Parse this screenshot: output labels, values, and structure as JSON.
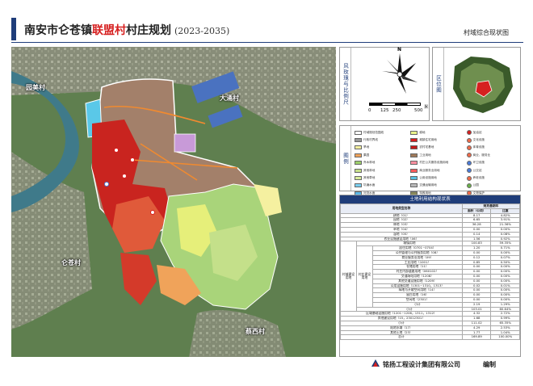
{
  "header": {
    "title_prefix": "南安市仑苍镇",
    "title_highlight": "联盟村",
    "title_suffix": "村庄规划",
    "title_years": "(2023-2035)",
    "subtitle": "村域综合现状图"
  },
  "map": {
    "places": [
      {
        "key": "yuanmei",
        "label": "园美村"
      },
      {
        "key": "dayong",
        "label": "大涌村"
      },
      {
        "key": "cangsu",
        "label": "仑苍村"
      },
      {
        "key": "caixi",
        "label": "蔡西村"
      }
    ]
  },
  "compass": {
    "label": "风玫瑰与比例尺",
    "north": "N",
    "scale_ticks": [
      "0",
      "125",
      "250",
      "500"
    ],
    "scale_unit": "米"
  },
  "location": {
    "label": "区位图"
  },
  "legend": {
    "label": "图例",
    "items": [
      {
        "text": "村域规划范围线",
        "color": "#ffffff",
        "shape": "box"
      },
      {
        "text": "耕地",
        "color": "#e8f28a",
        "shape": "box"
      },
      {
        "text": "加油站",
        "color": "#d62020",
        "shape": "dot"
      },
      {
        "text": "行政村界线",
        "color": "#999999",
        "shape": "box"
      },
      {
        "text": "城镇住宅用地",
        "color": "#d62020",
        "shape": "box"
      },
      {
        "text": "文化设施",
        "color": "#ef6a4a",
        "shape": "dot"
      },
      {
        "text": "旱地",
        "color": "#f5f0a0",
        "shape": "box"
      },
      {
        "text": "农村宅基地",
        "color": "#c41a1a",
        "shape": "box"
      },
      {
        "text": "体育设施",
        "color": "#ef6a4a",
        "shape": "dot"
      },
      {
        "text": "果园",
        "color": "#f0a35a",
        "shape": "box"
      },
      {
        "text": "工业用地",
        "color": "#a07a5a",
        "shape": "box"
      },
      {
        "text": "商业、服务业",
        "color": "#ef6a4a",
        "shape": "dot"
      },
      {
        "text": "乔木林地",
        "color": "#9ccf6a",
        "shape": "box"
      },
      {
        "text": "村庄公共服务设施用地",
        "color": "#ff8fa0",
        "shape": "box"
      },
      {
        "text": "环卫设施",
        "color": "#4a7ad8",
        "shape": "dot"
      },
      {
        "text": "其他林地",
        "color": "#c8e08a",
        "shape": "box"
      },
      {
        "text": "商业服务业用地",
        "color": "#ff5a5a",
        "shape": "box"
      },
      {
        "text": "公交站",
        "color": "#4a7ad8",
        "shape": "dot"
      },
      {
        "text": "其他草地",
        "color": "#d8ec9a",
        "shape": "box"
      },
      {
        "text": "公用设施用地",
        "color": "#5ac0e0",
        "shape": "box"
      },
      {
        "text": "养老设施",
        "color": "#ef6a4a",
        "shape": "dot"
      },
      {
        "text": "坑塘水面",
        "color": "#7ad0f0",
        "shape": "box"
      },
      {
        "text": "交通运输用地",
        "color": "#b8b8b8",
        "shape": "box"
      },
      {
        "text": "公园",
        "color": "#6ab04a",
        "shape": "dot"
      },
      {
        "text": "河流水面",
        "color": "#5ab8e8",
        "shape": "box"
      },
      {
        "text": "特殊用地",
        "color": "#8a8a5a",
        "shape": "box"
      },
      {
        "text": "文物保护",
        "color": "#ef6a4a",
        "shape": "dot"
      }
    ]
  },
  "table": {
    "title": "土地利用结构现状表",
    "head": {
      "col1": "用地类型名称",
      "col2": "规划基期年",
      "col3": "面积（公顷）",
      "col4": "比重"
    },
    "rows": [
      {
        "name": "耕地（01）",
        "area": "8.17",
        "pct": "4.82%"
      },
      {
        "name": "园地（02）",
        "area": "6.65",
        "pct": "3.91%"
      },
      {
        "name": "林地（03）",
        "area": "36.28",
        "pct": "21.36%"
      },
      {
        "name": "草地（04）",
        "area": "0.00",
        "pct": "0.00%"
      },
      {
        "name": "湿地（05）",
        "area": "0.14",
        "pct": "0.08%"
      },
      {
        "name": "农业设施建设用地（06）",
        "area": "1.56",
        "pct": "0.92%"
      },
      {
        "name": "城镇用地",
        "area": "100.83",
        "pct": "59.35%"
      },
      {
        "name": "居住用地（0701~0704）",
        "area": "1.20",
        "pct": "0.71%"
      },
      {
        "name": "公共管理与公共服务用地（08）",
        "area": "0.00",
        "pct": "0.00%"
      },
      {
        "name": "商业服务业用地（09）",
        "area": "0.12",
        "pct": "0.07%"
      },
      {
        "name": "工业用地（1001）",
        "area": "0.85",
        "pct": "0.50%"
      },
      {
        "name": "仓储用地（11）",
        "area": "0.00",
        "pct": "0.00%"
      },
      {
        "name": "村庄内部道路用地（060102）",
        "area": "0.00",
        "pct": "0.00%"
      },
      {
        "name": "交通场站用地（1208）",
        "area": "0.00",
        "pct": "0.00%"
      },
      {
        "name": "其他交通设施用地（1209）",
        "area": "0.00",
        "pct": "0.00%"
      },
      {
        "name": "公用设施用地（1301~1310，1313）",
        "area": "0.02",
        "pct": "0.01%"
      },
      {
        "name": "绿地与开敞空间用地（14）",
        "area": "0.00",
        "pct": "0.00%"
      },
      {
        "name": "留白用地（16）",
        "area": "0.00",
        "pct": "0.00%"
      },
      {
        "name": "空闲地（2301）",
        "area": "0.00",
        "pct": "0.00%"
      },
      {
        "name": "小计",
        "area": "2.19",
        "pct": "1.29%"
      },
      {
        "name": "小计",
        "area": "103.01",
        "pct": "60.64%"
      },
      {
        "name": "区域基础设施用地（1201~1206，1311，1312）",
        "area": "4.32",
        "pct": "2.72%"
      },
      {
        "name": "其他建设用地（15，23012301）",
        "area": "1.68",
        "pct": "0.99%"
      },
      {
        "name": "小计",
        "area": "111.02",
        "pct": "65.35%"
      },
      {
        "name": "陆地水域（17）",
        "area": "4.29",
        "pct": "2.53%"
      },
      {
        "name": "其他土地（23）",
        "area": "1.77",
        "pct": "1.04%"
      },
      {
        "name": "总计",
        "area": "169.89",
        "pct": "100.00%"
      }
    ],
    "group_label_a": "村域建设用地",
    "group_label_b": "村庄建设用地"
  },
  "footer": {
    "company": "铭扬工程设计集团有限公司",
    "role": "编制"
  }
}
